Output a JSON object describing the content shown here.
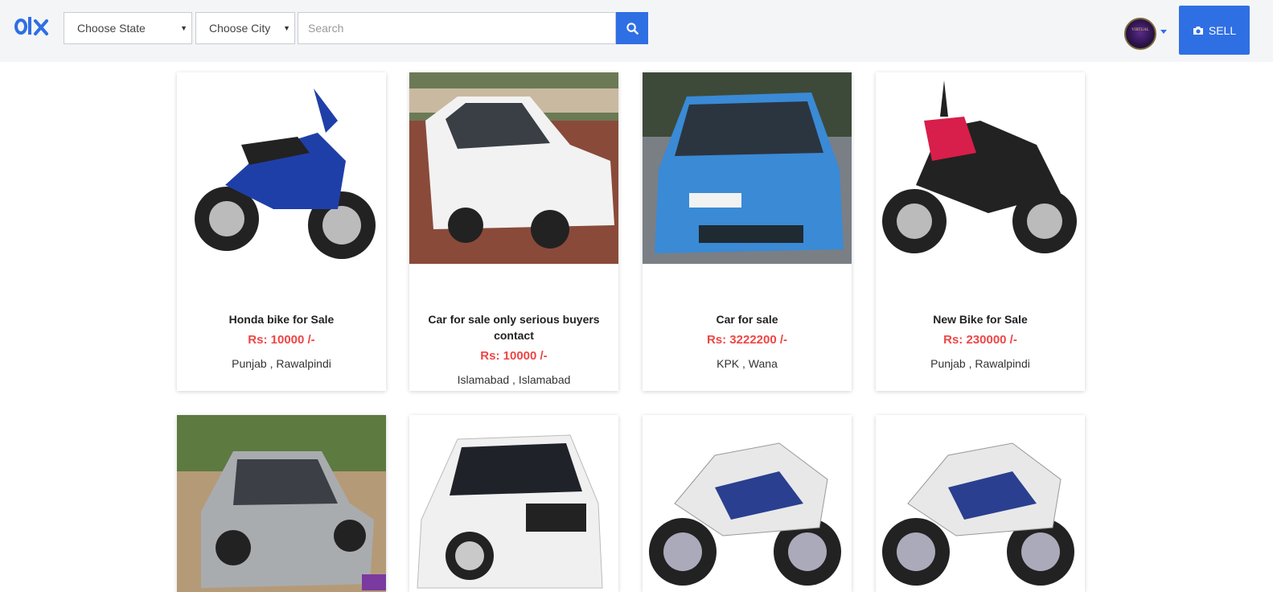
{
  "header": {
    "logo_alt": "olx",
    "state_select": "Choose State",
    "city_select": "Choose City",
    "search_placeholder": "Search",
    "avatar_text": "VIRTUAL",
    "sell_label": "SELL"
  },
  "listings": [
    {
      "title": "Honda bike for Sale",
      "price": "Rs: 10000 /-",
      "location": "Punjab , Rawalpindi",
      "image": "blue-motorcycle"
    },
    {
      "title": "Car for sale only serious buyers contact",
      "price": "Rs: 10000 /-",
      "location": "Islamabad , Islamabad",
      "image": "white-car"
    },
    {
      "title": "Car for sale",
      "price": "Rs: 3222200 /-",
      "location": "KPK , Wana",
      "image": "blue-car"
    },
    {
      "title": "New Bike for Sale",
      "price": "Rs: 230000 /-",
      "location": "Punjab , Rawalpindi",
      "image": "red-motorcycle"
    },
    {
      "title": "",
      "price": "",
      "location": "",
      "image": "silver-car"
    },
    {
      "title": "",
      "price": "",
      "location": "",
      "image": "white-swift"
    },
    {
      "title": "",
      "price": "",
      "location": "",
      "image": "white-blue-sportbike"
    },
    {
      "title": "",
      "price": "",
      "location": "",
      "image": "white-blue-sportbike"
    }
  ],
  "colors": {
    "accent": "#2f6fe4",
    "price": "#ef4545"
  }
}
